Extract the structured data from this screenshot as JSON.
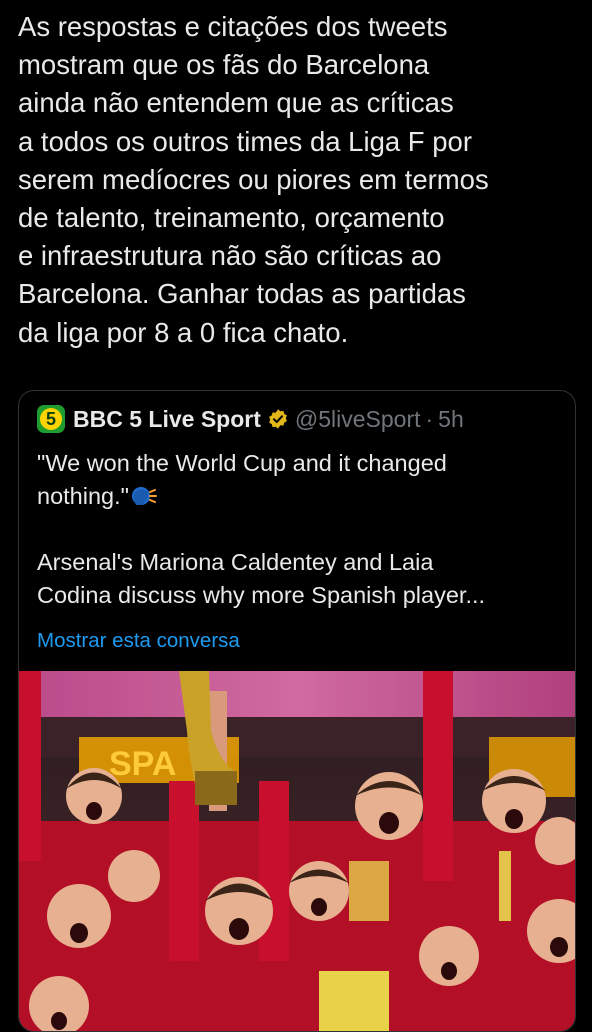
{
  "post": {
    "text": "As respostas e citações dos tweets\nmostram que os fãs do Barcelona\nainda não entendem que as críticas\na todos os outros times da Liga F por\nserem medíocres ou piores em termos\nde talento, treinamento, orçamento\ne infraestrutura não são críticas ao\nBarcelona. Ganhar todas as partidas\nda liga por 8 a 0 fica chato."
  },
  "quoted_post": {
    "avatar_label": "5",
    "display_name": "BBC 5 Live Sport",
    "verified_icon": "verified-gold-badge-icon",
    "handle": "@5liveSport",
    "separator": "·",
    "time": "5h",
    "text_line1": "\"We won the World Cup and it changed\nnothing.\"",
    "emoji_icon": "speaking-head-icon",
    "text_line2": "Arsenal's Mariona Caldentey and Laia\nCodina discuss why more Spanish player...",
    "show_thread": "Mostrar esta conversa",
    "media_icon": "team-celebration-photo",
    "media_logo_text": "SPA"
  },
  "colors": {
    "background": "#000000",
    "text": "#e7e9ea",
    "muted": "#71767b",
    "link": "#1d9bf0",
    "border": "#2f3336",
    "jersey_red": "#c8102e",
    "banner_pink": "#c8508c",
    "gold": "#c9a227"
  }
}
